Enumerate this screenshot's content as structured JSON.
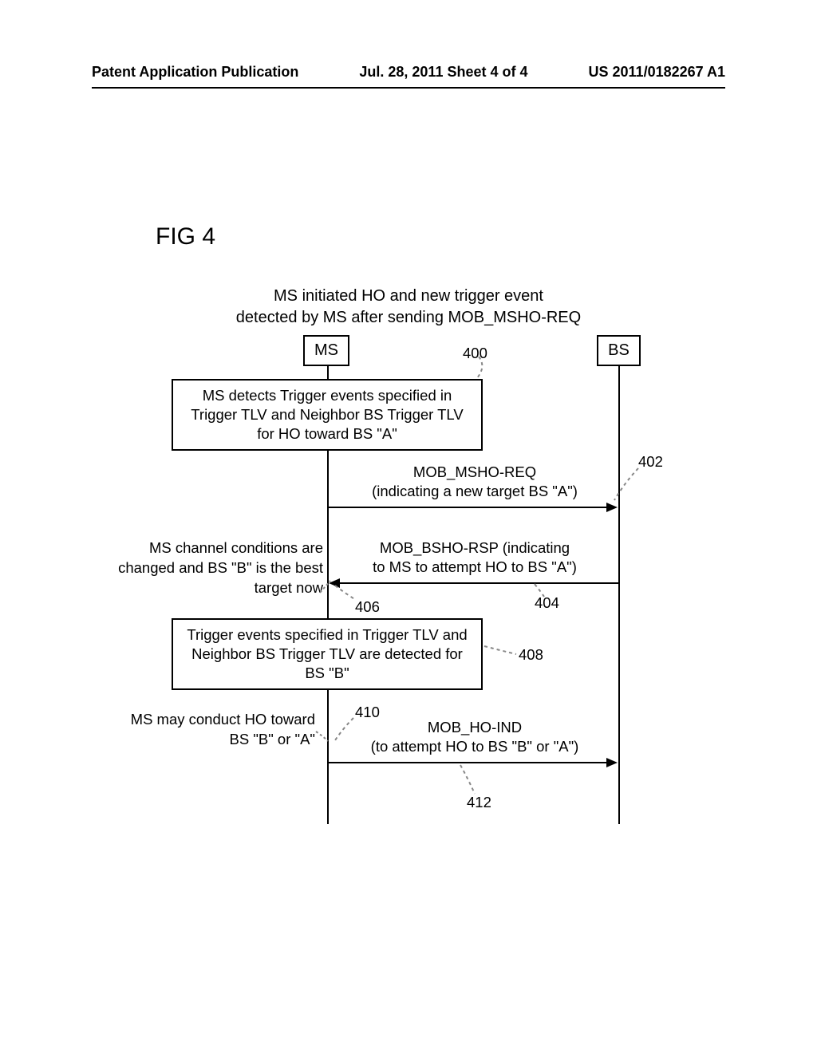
{
  "header": {
    "left": "Patent Application Publication",
    "center": "Jul. 28, 2011   Sheet 4 of 4",
    "right": "US 2011/0182267 A1"
  },
  "figure": {
    "label": "FIG 4",
    "title_line1": "MS initiated HO and new trigger event",
    "title_line2": "detected by MS after sending MOB_MSHO-REQ",
    "actors": {
      "ms": "MS",
      "bs": "BS"
    },
    "box_400": "MS detects Trigger events specified in Trigger TLV and Neighbor BS Trigger TLV for HO toward BS \"A\"",
    "box_408": "Trigger events specified in Trigger TLV and Neighbor BS Trigger TLV are detected for BS \"B\"",
    "msg_402_line1": "MOB_MSHO-REQ",
    "msg_402_line2": "(indicating a new target BS \"A\")",
    "msg_404_line1": "MOB_BSHO-RSP (indicating",
    "msg_404_line2": "to MS to attempt HO to BS \"A\")",
    "msg_412_line1": "MOB_HO-IND",
    "msg_412_line2": "(to attempt HO to BS \"B\" or \"A\")",
    "note_406": "MS channel conditions are changed and BS \"B\" is the best target now",
    "note_410": "MS may conduct HO toward BS \"B\" or \"A\"",
    "refs": {
      "r400": "400",
      "r402": "402",
      "r404": "404",
      "r406": "406",
      "r408": "408",
      "r410": "410",
      "r412": "412"
    }
  }
}
